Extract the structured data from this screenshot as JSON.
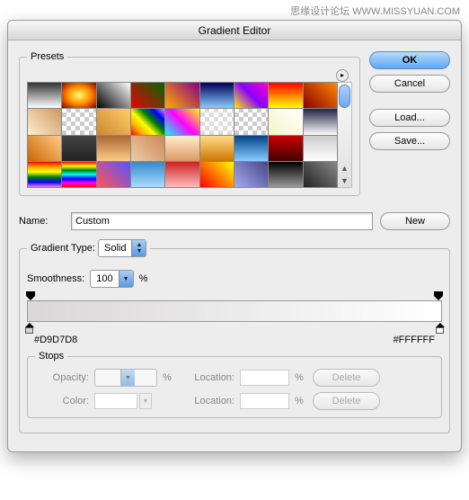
{
  "watermark": "思缘设计论坛  WWW.MISSYUAN.COM",
  "title": "Gradient Editor",
  "presets": {
    "legend": "Presets"
  },
  "buttons": {
    "ok": "OK",
    "cancel": "Cancel",
    "load": "Load...",
    "save": "Save...",
    "new": "New",
    "delete": "Delete"
  },
  "name": {
    "label": "Name:",
    "value": "Custom"
  },
  "gradient": {
    "type_label": "Gradient Type:",
    "type_value": "Solid",
    "smooth_label": "Smoothness:",
    "smooth_value": "100",
    "pct": "%",
    "left_hex": "#D9D7D8",
    "right_hex": "#FFFFFF"
  },
  "stops": {
    "legend": "Stops",
    "opacity_label": "Opacity:",
    "color_label": "Color:",
    "location_label": "Location:"
  },
  "swatch_gradients": [
    "linear-gradient(#333,#fff)",
    "radial-gradient(#ff6,#f80,#800)",
    "linear-gradient(45deg,#000,#fff)",
    "linear-gradient(45deg,#e00,#060)",
    "linear-gradient(45deg,#fa0,#808)",
    "linear-gradient(#005,#8cf)",
    "linear-gradient(45deg,#fe0,#80f,#f0c)",
    "linear-gradient(#f00,#ff0)",
    "linear-gradient(45deg,#800,#f80)",
    "linear-gradient(45deg,#fec,#c96)",
    "repeating-conic-gradient(#ccc 0 25%,#fff 0 50%) 0/10px 10px",
    "linear-gradient(45deg,#c83,#fc6)",
    "linear-gradient(45deg,red,orange,yellow,green,blue,violet)",
    "linear-gradient(45deg,#0ff,#f0f,#ff0)",
    "repeating-conic-gradient(#ddd 0 25%,#fff 0 50%) 0/10px 10px",
    "repeating-conic-gradient(#ccc 0 25%,#fff 0 50%) 0/10px 10px",
    "linear-gradient(45deg,#f5f5c8,#fff)",
    "linear-gradient(#224,#fff)",
    "linear-gradient(45deg,#c60,#fc8)",
    "linear-gradient(#444,#222)",
    "linear-gradient(#a63,#fc8)",
    "linear-gradient(45deg,#eca,#c85)",
    "linear-gradient(#fec,#d96)",
    "linear-gradient(#fd8,#c70)",
    "linear-gradient(#048,#8cf)",
    "linear-gradient(#c00,#400)",
    "linear-gradient(#ccc,#fff)",
    "linear-gradient(red,orange,yellow,green,blue,violet)",
    "linear-gradient(red,yellow,green,cyan,blue,magenta,red)",
    "linear-gradient(45deg,#f55,#55f)",
    "linear-gradient(#38c,#adf)",
    "linear-gradient(#c22,#fbb)",
    "linear-gradient(45deg,#f00,#ff0)",
    "linear-gradient(45deg,#aae,#448)",
    "linear-gradient(#000,#999)",
    "linear-gradient(45deg,#222,#888)"
  ]
}
